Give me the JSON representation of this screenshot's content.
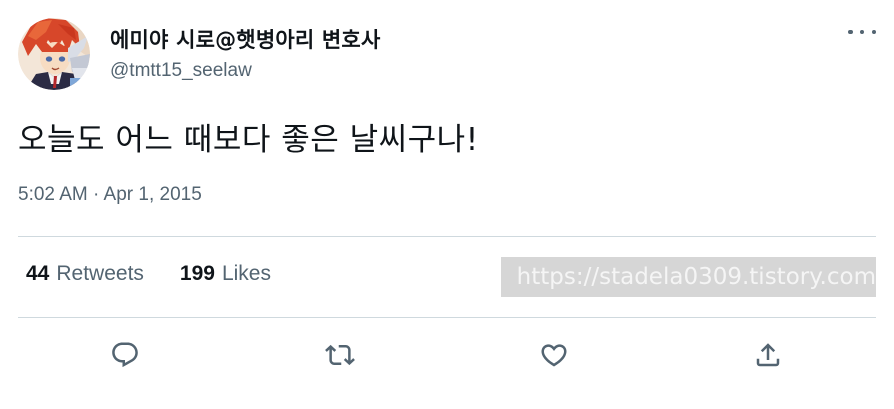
{
  "user": {
    "display_name": "에미야 시로@햇병아리 변호사",
    "handle": "@tmtt15_seelaw",
    "avatar_icon": "avatar-image"
  },
  "tweet": {
    "text": "오늘도 어느 때보다 좋은 날씨구나!",
    "timestamp": "5:02 AM · Apr 1, 2015"
  },
  "stats": {
    "retweets_count": "44",
    "retweets_label": "Retweets",
    "likes_count": "199",
    "likes_label": "Likes"
  },
  "watermark": {
    "text": "https://stadela0309.tistory.com"
  },
  "actions": [
    {
      "name": "reply",
      "icon": "reply-icon"
    },
    {
      "name": "retweet",
      "icon": "retweet-icon"
    },
    {
      "name": "like",
      "icon": "heart-icon"
    },
    {
      "name": "share",
      "icon": "share-icon"
    }
  ],
  "colors": {
    "text_primary": "#0f1419",
    "text_secondary": "#536471",
    "divider": "#cfd9de",
    "watermark_bg": "#d6d6d6"
  }
}
